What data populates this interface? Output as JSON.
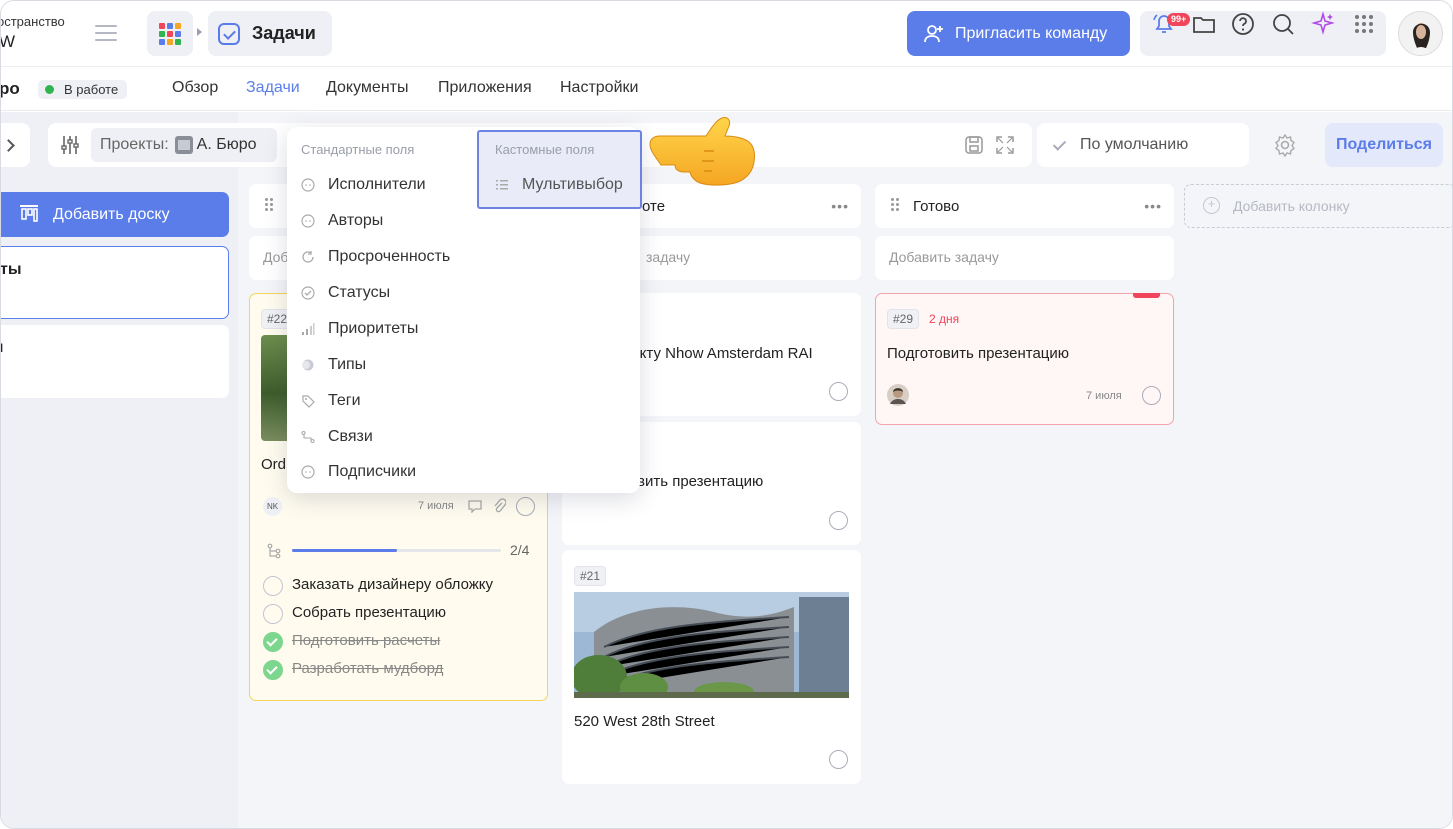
{
  "workspace": {
    "name": "остранство",
    "sub": "W"
  },
  "breadcrumb": {
    "title": "Задачи"
  },
  "header": {
    "invite_label": "Пригласить команду",
    "notif_badge": "99+",
    "apps_colors": [
      "#f0455a",
      "#5b7de9",
      "#f5a623",
      "#31b450",
      "#f0455a",
      "#5b7de9",
      "#5b7de9",
      "#f5a623",
      "#31b450"
    ]
  },
  "project": {
    "name": "ро",
    "status": "В работе",
    "status_color": "#31b450"
  },
  "tabs": [
    {
      "label": "Обзор",
      "active": false
    },
    {
      "label": "Задачи",
      "active": true
    },
    {
      "label": "Документы",
      "active": false
    },
    {
      "label": "Приложения",
      "active": false
    },
    {
      "label": "Настройки",
      "active": false
    }
  ],
  "filters": {
    "projects_label": "Проекты:",
    "projects_value": "А. Бюро",
    "view_label": "По умолчанию",
    "share_label": "Поделиться"
  },
  "sidebar": {
    "add_board_label": "Добавить доску",
    "boards": [
      {
        "title": "ты"
      },
      {
        "title": "ı"
      }
    ]
  },
  "columns": [
    {
      "title": "",
      "add_task": "Доб"
    },
    {
      "title": "оте",
      "add_task": "задачу"
    },
    {
      "title": "Готово",
      "add_task": "Добавить задачу"
    }
  ],
  "add_column_label": "Добавить колонку",
  "cards": {
    "c1": {
      "num": "#22",
      "title": "Ord",
      "assignee_initials": "NK",
      "date": "7 июля",
      "progress_text": "2/4",
      "progress_fraction": 0.5,
      "checklist": [
        {
          "text": "Заказать дизайнеру обложку",
          "done": false
        },
        {
          "text": "Собрать презентацию",
          "done": false
        },
        {
          "text": "Подготовить расчеты",
          "done": true
        },
        {
          "text": "Разработать мудборд",
          "done": true
        }
      ]
    },
    "c2": {
      "title": "оекту Nhow Amsterdam RAI"
    },
    "c3": {
      "title": "вить презентацию"
    },
    "c4": {
      "num": "#21",
      "title": "520 West 28th Street"
    },
    "c5": {
      "num": "#29",
      "overdue": "2 дня",
      "title": "Подготовить презентацию",
      "date": "7 июля"
    }
  },
  "dropdown": {
    "standard_header": "Стандартные поля",
    "custom_header": "Кастомные поля",
    "standard_items": [
      "Исполнители",
      "Авторы",
      "Просроченность",
      "Статусы",
      "Приоритеты",
      "Типы",
      "Теги",
      "Связи",
      "Подписчики"
    ],
    "custom_items": [
      "Мультивыбор"
    ]
  },
  "colors": {
    "accent": "#5b7de9",
    "danger": "#f0455a",
    "success": "#31b450"
  }
}
